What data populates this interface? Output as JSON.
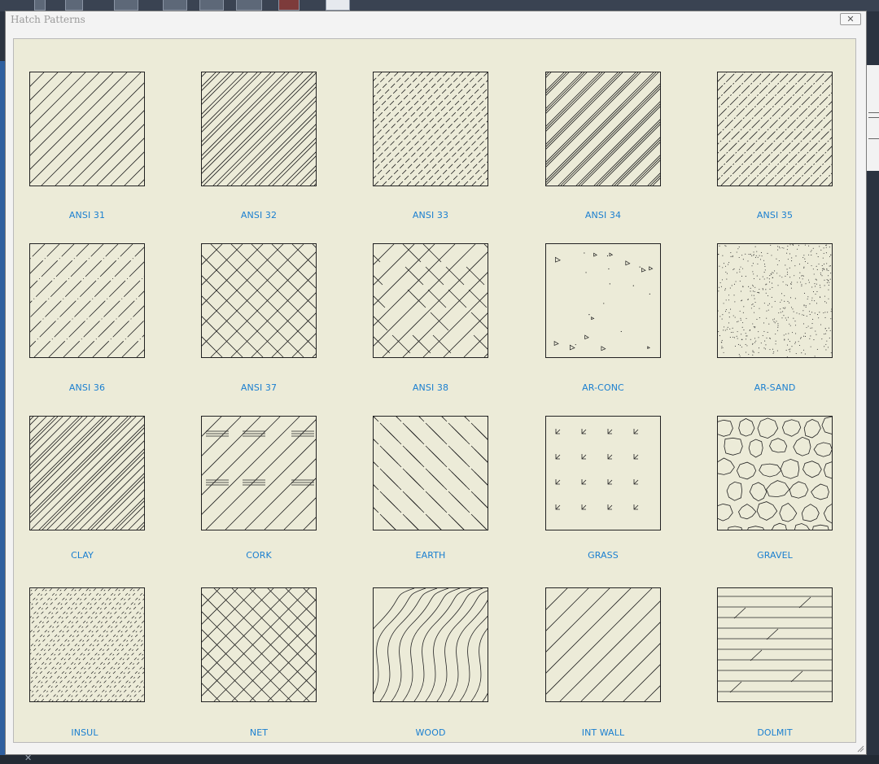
{
  "dialog": {
    "title": "Hatch Patterns",
    "close_label": "✕"
  },
  "patterns": [
    {
      "label": "ANSI 31",
      "icon": "diagonal-lines-pattern"
    },
    {
      "label": "ANSI 32",
      "icon": "diagonal-double-lines-pattern"
    },
    {
      "label": "ANSI 33",
      "icon": "diagonal-dashed-lines-pattern"
    },
    {
      "label": "ANSI 34",
      "icon": "diagonal-triple-lines-pattern"
    },
    {
      "label": "ANSI 35",
      "icon": "diagonal-mixed-lines-pattern"
    },
    {
      "label": "ANSI 36",
      "icon": "diagonal-dot-dash-pattern"
    },
    {
      "label": "ANSI 37",
      "icon": "crosshatch-pattern"
    },
    {
      "label": "ANSI 38",
      "icon": "crosshatch-broken-pattern"
    },
    {
      "label": "AR-CONC",
      "icon": "concrete-pattern"
    },
    {
      "label": "AR-SAND",
      "icon": "sand-pattern"
    },
    {
      "label": "CLAY",
      "icon": "clay-pattern"
    },
    {
      "label": "CORK",
      "icon": "cork-pattern"
    },
    {
      "label": "EARTH",
      "icon": "earth-pattern"
    },
    {
      "label": "GRASS",
      "icon": "grass-pattern"
    },
    {
      "label": "GRAVEL",
      "icon": "gravel-pattern"
    },
    {
      "label": "INSUL",
      "icon": "insulation-pattern"
    },
    {
      "label": "NET",
      "icon": "net-pattern"
    },
    {
      "label": "WOOD",
      "icon": "wood-grain-pattern"
    },
    {
      "label": "INT WALL",
      "icon": "interior-wall-pattern"
    },
    {
      "label": "DOLMIT",
      "icon": "dolomite-pattern"
    }
  ],
  "colors": {
    "label": "#1a7fd0",
    "swatch_bg": "#ecebd8",
    "stroke": "#222222"
  }
}
